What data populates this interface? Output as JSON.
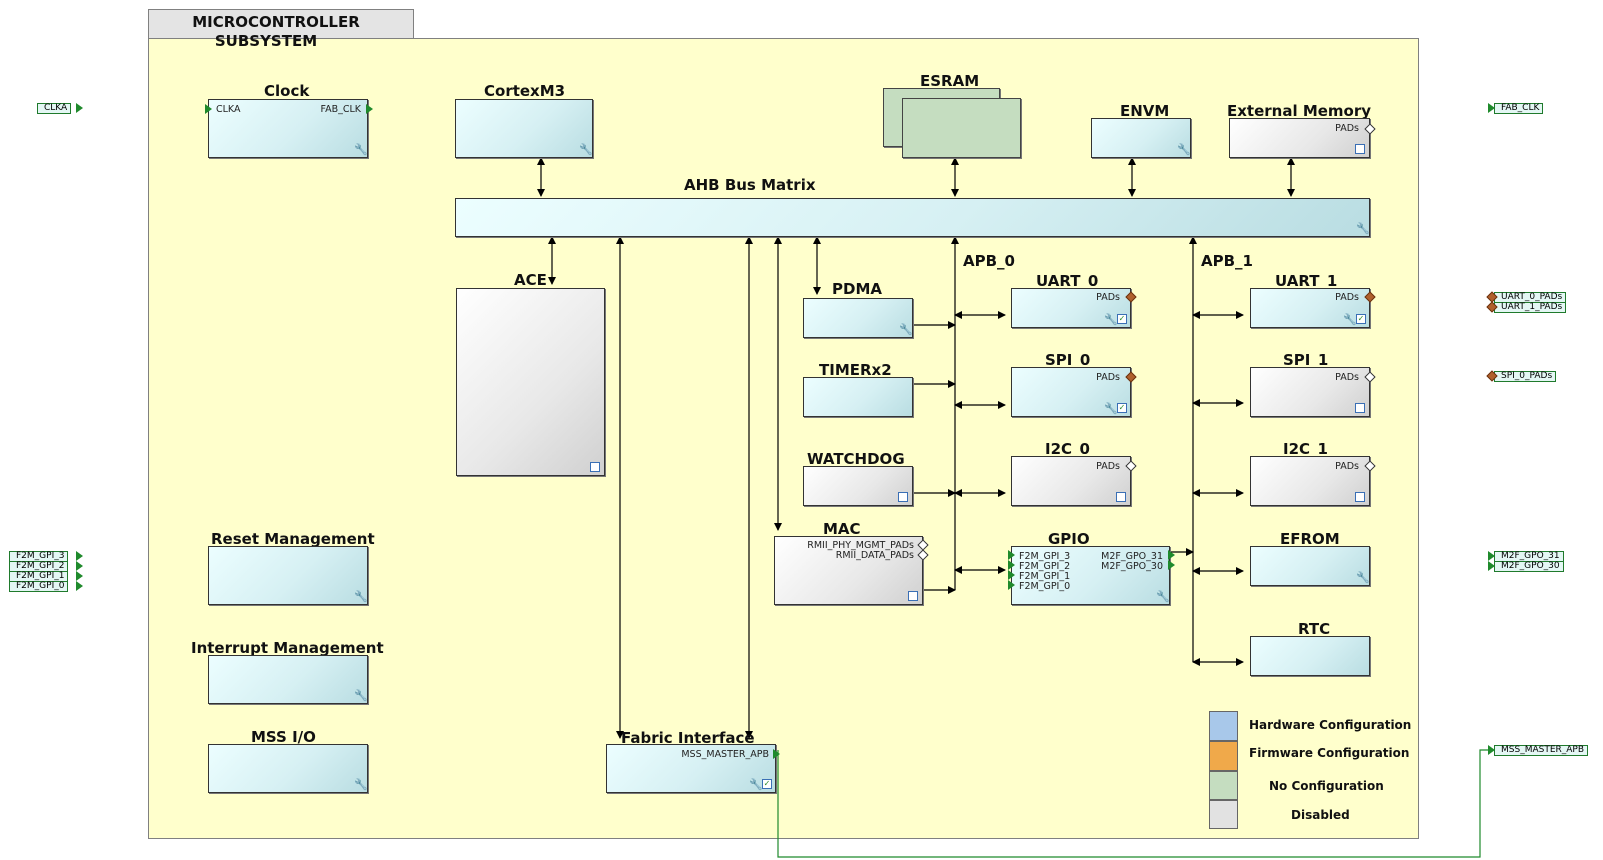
{
  "panel": {
    "title_line1": "MICROCONTROLLER",
    "title_line2": "SUBSYSTEM"
  },
  "blocks": {
    "clock": {
      "label": "Clock",
      "pin_in": "CLKA",
      "pin_out": "FAB_CLK"
    },
    "cortexm3": {
      "label": "CortexM3"
    },
    "esram": {
      "label": "ESRAM"
    },
    "envm": {
      "label": "ENVM"
    },
    "external_memory": {
      "label": "External Memory",
      "pin": "PADs"
    },
    "ahb": {
      "label": "AHB Bus Matrix"
    },
    "ace": {
      "label": "ACE"
    },
    "pdma": {
      "label": "PDMA"
    },
    "timer": {
      "label": "TIMERx2"
    },
    "watchdog": {
      "label": "WATCHDOG"
    },
    "mac": {
      "label": "MAC",
      "pin1": "RMII_PHY_MGMT_PADs",
      "pin2": "RMII_DATA_PADs"
    },
    "uart0": {
      "label": "UART_0",
      "pin": "PADs"
    },
    "spi0": {
      "label": "SPI_0",
      "pin": "PADs"
    },
    "i2c0": {
      "label": "I2C_0",
      "pin": "PADs"
    },
    "gpio": {
      "label": "GPIO",
      "in_pins": [
        "F2M_GPI_3",
        "F2M_GPI_2",
        "F2M_GPI_1",
        "F2M_GPI_0"
      ],
      "out_pins": [
        "M2F_GPO_31",
        "M2F_GPO_30"
      ]
    },
    "uart1": {
      "label": "UART_1",
      "pin": "PADs"
    },
    "spi1": {
      "label": "SPI_1",
      "pin": "PADs"
    },
    "i2c1": {
      "label": "I2C_1",
      "pin": "PADs"
    },
    "efrom": {
      "label": "EFROM"
    },
    "rtc": {
      "label": "RTC"
    },
    "reset": {
      "label": "Reset Management"
    },
    "interrupt": {
      "label": "Interrupt Management"
    },
    "mssio": {
      "label": "MSS I/O"
    },
    "fabric": {
      "label": "Fabric Interface",
      "pin": "MSS_MASTER_APB"
    }
  },
  "buses": {
    "apb0": "APB_0",
    "apb1": "APB_1"
  },
  "ports": {
    "left": {
      "clka": "CLKA",
      "gpi": [
        "F2M_GPI_3",
        "F2M_GPI_2",
        "F2M_GPI_1",
        "F2M_GPI_0"
      ]
    },
    "right": {
      "fab_clk": "FAB_CLK",
      "uart0": "UART_0_PADs",
      "uart1": "UART_1_PADs",
      "spi0": "SPI_0_PADs",
      "gpo": [
        "M2F_GPO_31",
        "M2F_GPO_30"
      ],
      "mss_master_apb": "MSS_MASTER_APB"
    }
  },
  "legend": {
    "items": [
      {
        "label": "Hardware Configuration",
        "color": "#a8c8ea"
      },
      {
        "label": "Firmware Configuration",
        "color": "#f0a94a"
      },
      {
        "label": "No Configuration",
        "color": "#c5ddc0"
      },
      {
        "label": "Disabled",
        "color": "#e2e2e2"
      }
    ]
  },
  "colors": {
    "panel": "#ffffcc",
    "hardware": "#d6f0f3",
    "disabled": "#e8e8e8",
    "no_config": "#c5ddc0",
    "wire": "#000000",
    "net": "#1f8a2c"
  }
}
